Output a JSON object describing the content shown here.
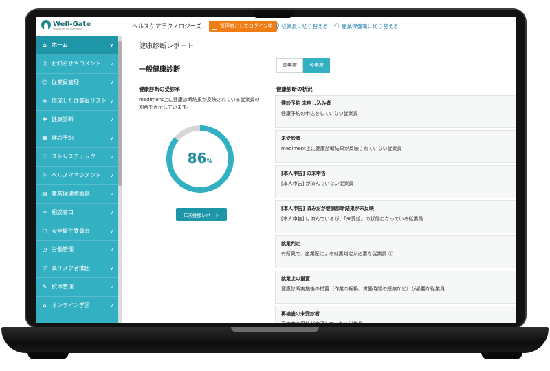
{
  "header": {
    "logo": "Well-Gate",
    "logo_sub": "Supported by mediment",
    "company": "ヘルスケアテクノロジーズ…",
    "admin_login": "管理者としてログイン中",
    "switch_employee": "従業員に切り替える",
    "switch_occupational": "産業保健職に切り替える"
  },
  "sidebar": {
    "items": [
      {
        "label": "ホーム",
        "icon": "home-icon",
        "glyph": "⌂"
      },
      {
        "label": "お知らせやコメント",
        "icon": "bell-icon",
        "glyph": "♫"
      },
      {
        "label": "従業員管理",
        "icon": "users-icon",
        "glyph": "☺"
      },
      {
        "label": "作成した従業員リスト",
        "icon": "list-icon",
        "glyph": "≡"
      },
      {
        "label": "健康診断",
        "icon": "checkup-icon",
        "glyph": "✚"
      },
      {
        "label": "健診予約",
        "icon": "calendar-icon",
        "glyph": "▦"
      },
      {
        "label": "ストレスチェック",
        "icon": "heart-icon",
        "glyph": "♡"
      },
      {
        "label": "ヘルスマネジメント",
        "icon": "health-icon",
        "glyph": "☼"
      },
      {
        "label": "産業保健職面談",
        "icon": "interview-icon",
        "glyph": "▤"
      },
      {
        "label": "相談窓口",
        "icon": "chat-icon",
        "glyph": "✉"
      },
      {
        "label": "安全衛生委員会",
        "icon": "document-icon",
        "glyph": "▢"
      },
      {
        "label": "労働管理",
        "icon": "clock-icon",
        "glyph": "◷"
      },
      {
        "label": "高リスク者抽出",
        "icon": "filter-icon",
        "glyph": "▽"
      },
      {
        "label": "抗体管理",
        "icon": "syringe-icon",
        "glyph": "✎"
      },
      {
        "label": "オンライン学習",
        "icon": "graduation-icon",
        "glyph": "⌂"
      }
    ]
  },
  "main": {
    "page_title": "健康診断レポート",
    "section_title": "一般健康診断",
    "year_tabs": [
      "前年度",
      "今年度"
    ],
    "rate": {
      "title": "健康診断の受診率",
      "description": "mediment上に健康診断結果が反映されている従業員の割合を表示しています。",
      "value": "86",
      "unit": "%",
      "fraction": 0.86
    },
    "report_button": "年次推移レポート",
    "status": {
      "title": "健康診断の状況",
      "cards": [
        {
          "title": "健診予約 未申し込み者",
          "desc": "健康予約の申込をしていない従業員"
        },
        {
          "title": "未受診者",
          "desc": "mediment上に健康診断結果が反映されていない従業員"
        },
        {
          "title": "[本人申告] の未申告",
          "desc": "[本人申告] が済んでいない従業員"
        },
        {
          "title": "[本人申告] 済みだが健康診断結果が未反映",
          "desc": "[本人申告] は済んでいるが、「未受診」の状態になっている従業員"
        },
        {
          "title": "就業判定",
          "desc": "有所見で、産業医による就業判定が必要な従業員 ⓘ"
        },
        {
          "title": "就業上の措置",
          "desc": "健康診断実施後の措置（作業の転換、労働時間の短縮など）が必要な従業員"
        },
        {
          "title": "再検査の未受診者",
          "desc": "再検査の受診が完了していない従業員"
        }
      ]
    }
  },
  "colors": {
    "accent": "#33b0c2",
    "accent_dark": "#1f95a8",
    "admin": "#ef7d14",
    "donut_track": "#d6d6d6"
  }
}
